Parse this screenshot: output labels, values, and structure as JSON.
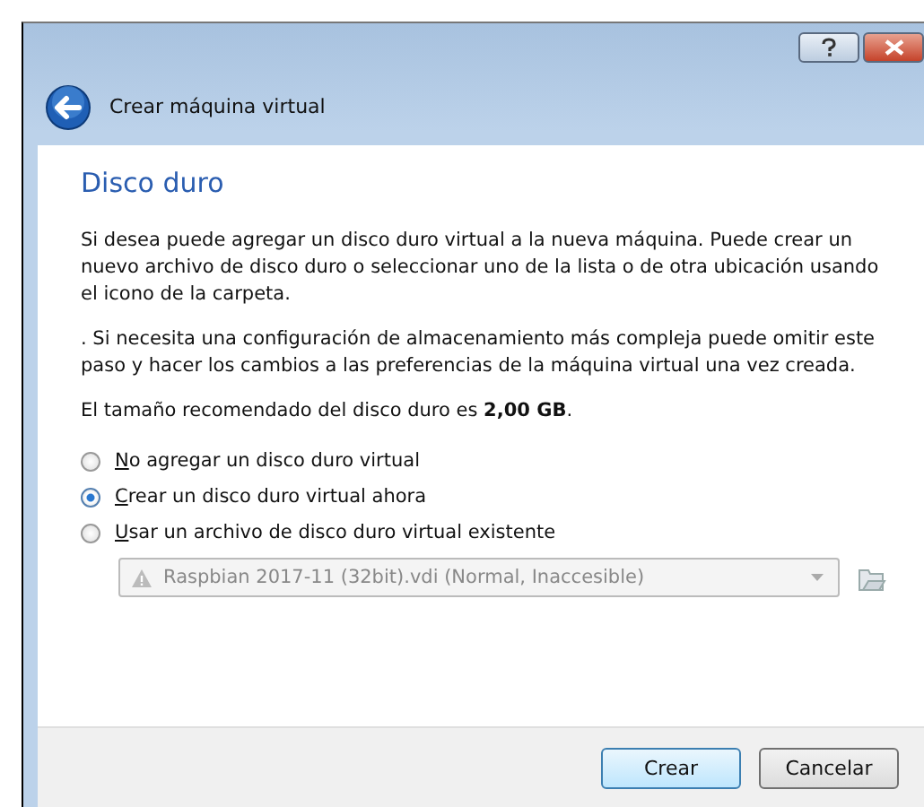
{
  "window": {
    "title": "Crear máquina virtual"
  },
  "page": {
    "heading": "Disco duro",
    "paragraphs": [
      "Si desea puede agregar un disco duro virtual a la nueva máquina. Puede crear un nuevo archivo de disco duro o seleccionar uno de la lista o de otra ubicación usando el icono de la carpeta.",
      ". Si necesita una configuración de almacenamiento más compleja puede omitir este paso y hacer los cambios a las preferencias de la máquina virtual una vez creada.",
      "El tamaño recomendado del disco duro es **2,00 GB**."
    ],
    "options": [
      {
        "label": "No agregar un disco duro virtual",
        "selected": false
      },
      {
        "label": "Crear un disco duro virtual ahora",
        "selected": true
      },
      {
        "label": "Usar un archivo de disco duro virtual existente",
        "selected": false
      }
    ],
    "disk_select": {
      "value": "Raspbian 2017-11 (32bit).vdi (Normal, Inaccesible)",
      "disabled": true
    }
  },
  "buttons": [
    {
      "label": "Crear",
      "kind": "default"
    },
    {
      "label": "Cancelar",
      "kind": "normal"
    }
  ]
}
